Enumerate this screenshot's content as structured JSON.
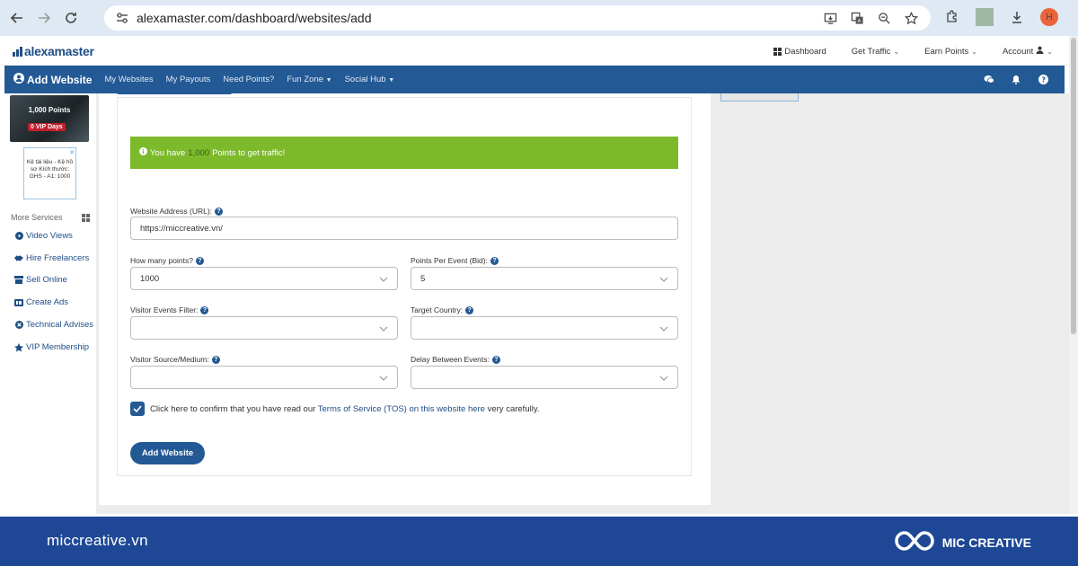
{
  "browser": {
    "url": "alexamaster.com/dashboard/websites/add",
    "profile_initial": "H"
  },
  "site": {
    "logo_text": "alexamaster",
    "topnav": {
      "dashboard": "Dashboard",
      "get_traffic": "Get Traffic",
      "earn_points": "Earn Points",
      "account": "Account"
    }
  },
  "bluenav": {
    "title": "Add Website",
    "links": [
      "My Websites",
      "My Payouts",
      "Need Points?",
      "Fun Zone",
      "Social Hub"
    ]
  },
  "sidebar": {
    "points": "1,000 Points",
    "vip_days": "0 VIP Days",
    "ad_text": "Kệ tài liệu - Kệ hồ sơ Kích thước: GHS - A1: 1000",
    "more_services": "More Services",
    "items": [
      "Video Views",
      "Hire Freelancers",
      "Sell Online",
      "Create Ads",
      "Technical Advises",
      "VIP Membership"
    ]
  },
  "alert": {
    "prefix": "You have",
    "points": "1,000",
    "suffix": "Points to get traffic!"
  },
  "form": {
    "url_label": "Website Address (URL):",
    "url_value": "https://miccreative.vn/",
    "points_label": "How many points?",
    "points_value": "1000",
    "ppe_label": "Points Per Event (Bid):",
    "ppe_value": "5",
    "events_filter_label": "Visitor Events Filter:",
    "target_country_label": "Target Country:",
    "source_label": "Visitor Source/Medium:",
    "delay_label": "Delay Between Events:",
    "confirm_prefix": "Click here to confirm that you have read our",
    "confirm_link": "Terms of Service (TOS) on this website here",
    "confirm_suffix": "very carefully.",
    "submit": "Add Website"
  },
  "footer": {
    "site": "miccreative.vn",
    "brand": "MIC CREATIVE"
  },
  "colors": {
    "nav_blue": "#235994",
    "alert_green": "#7cba2c",
    "footer_blue": "#1e4896"
  }
}
